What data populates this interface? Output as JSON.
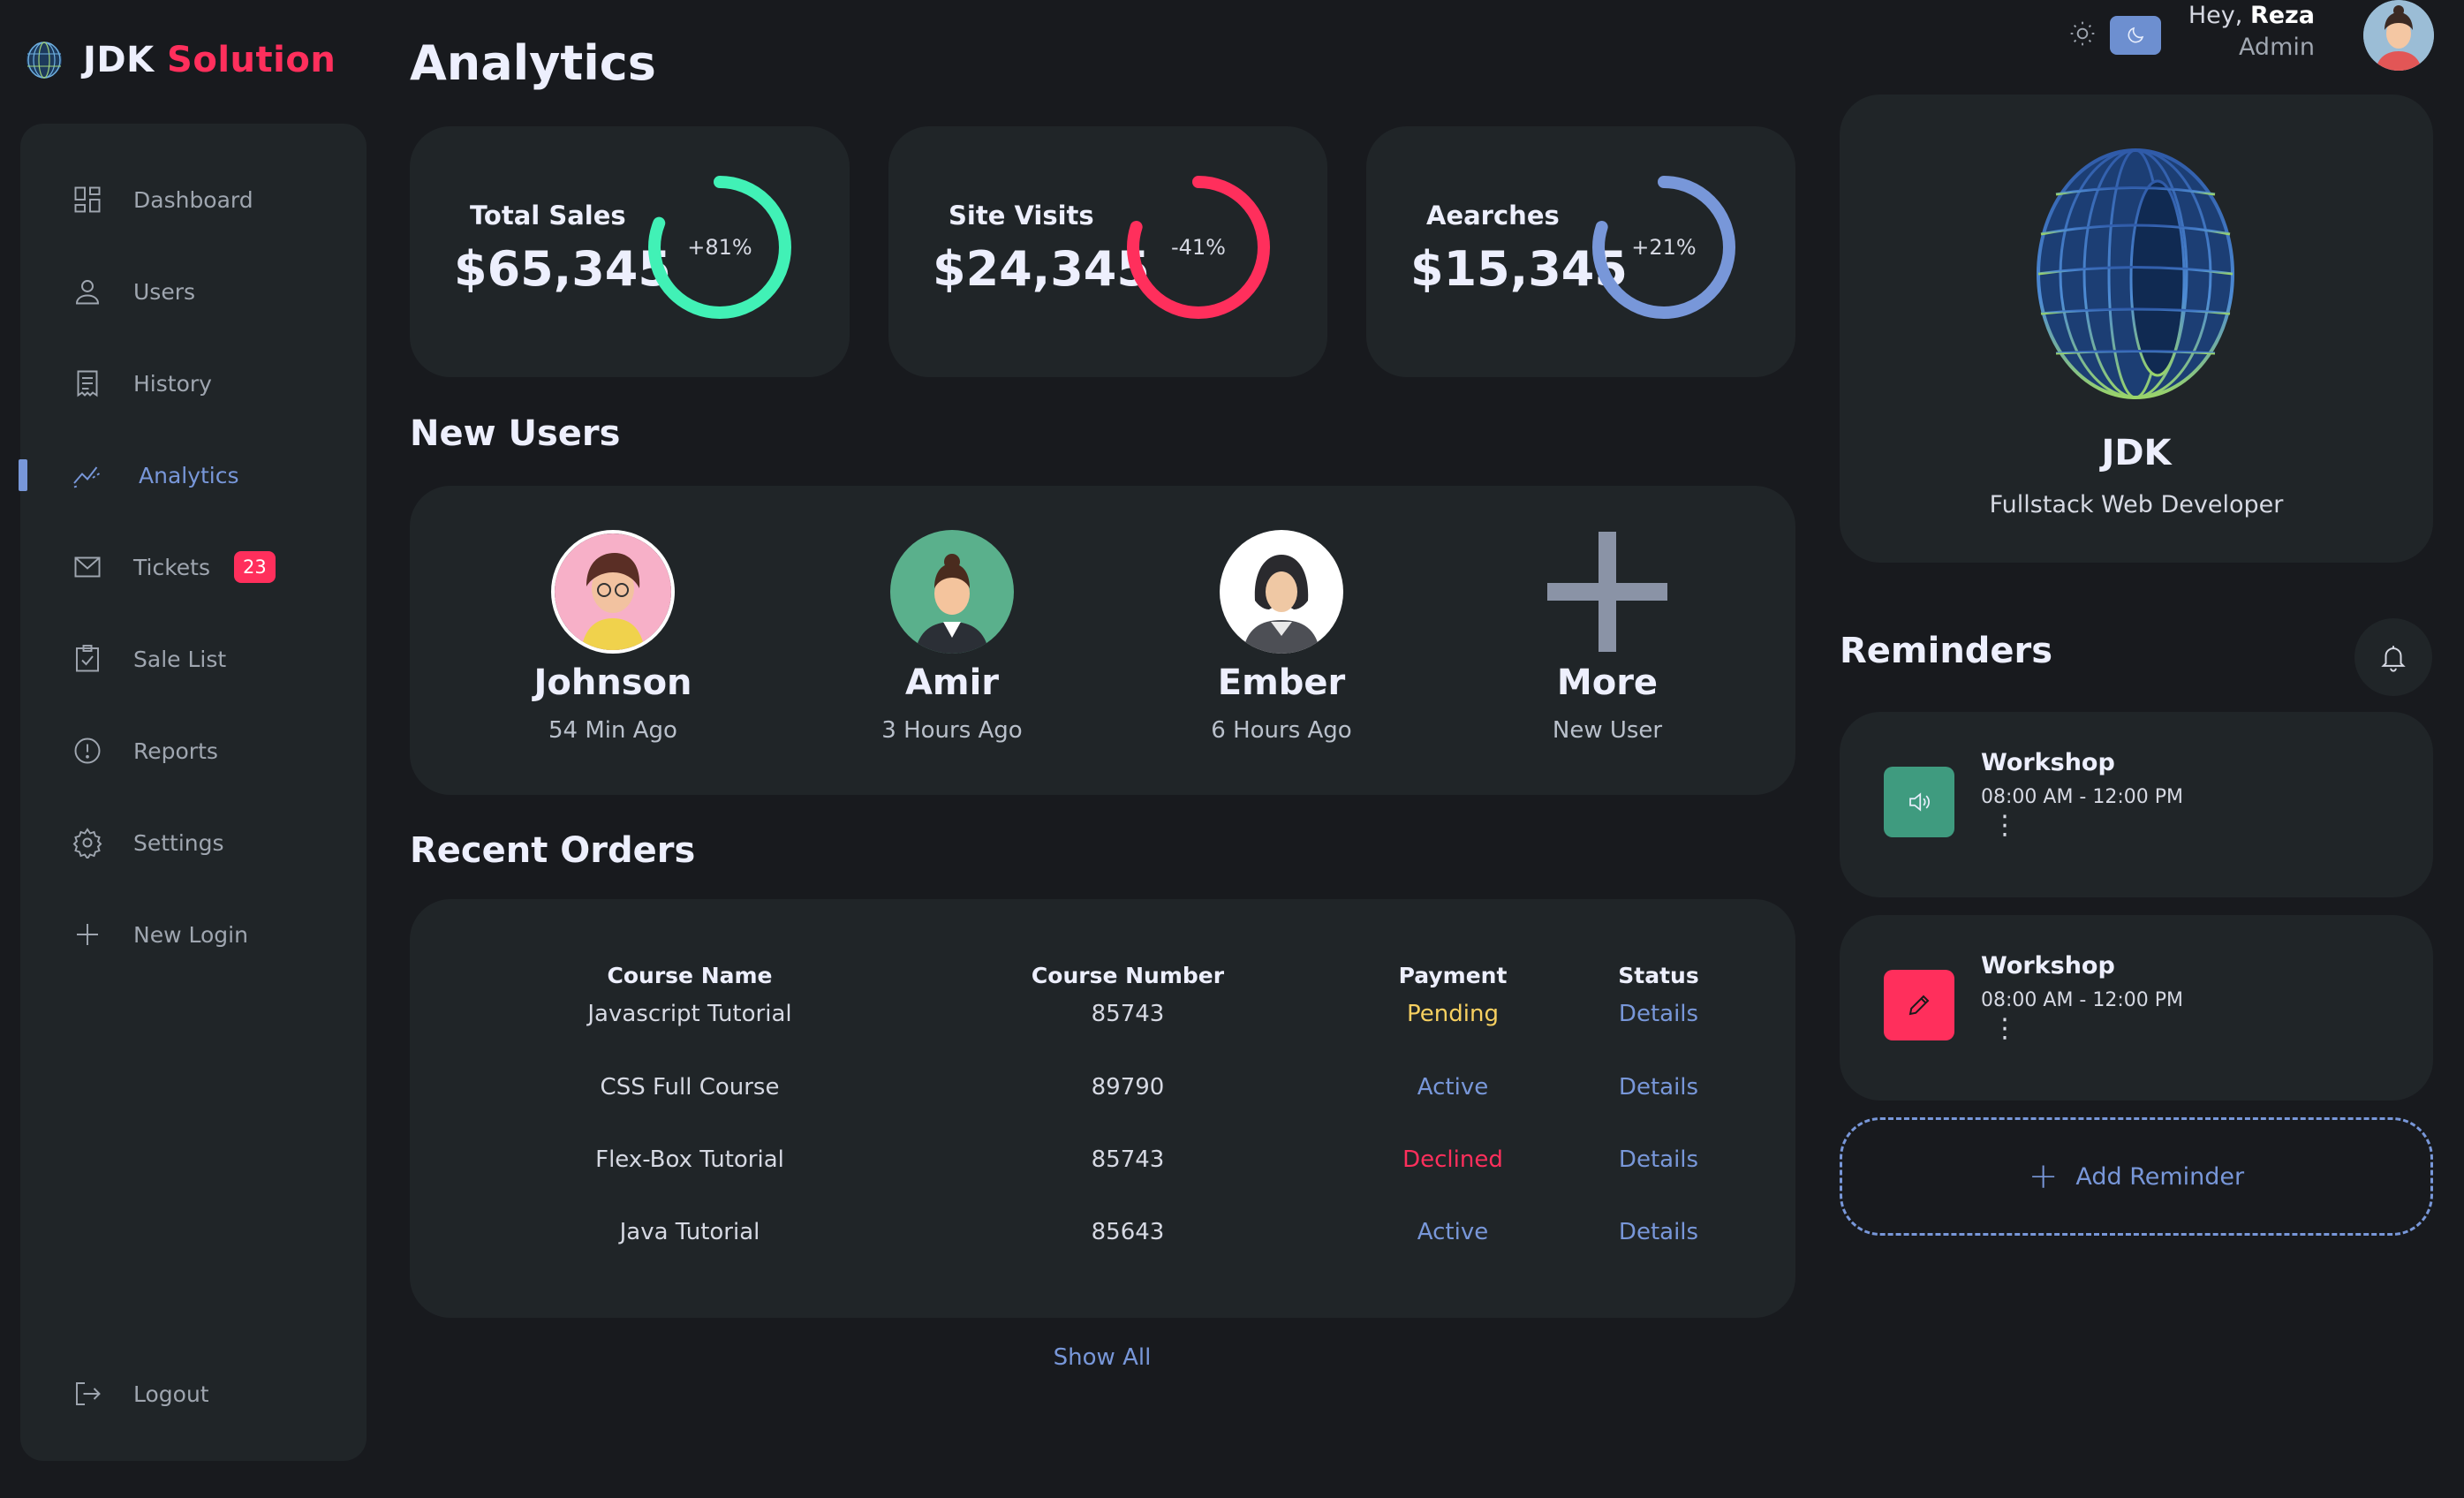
{
  "brand": {
    "part1": "JDK",
    "part2": "Solution",
    "accent": "#ff2f5c"
  },
  "sidebar": {
    "items": [
      {
        "label": "Dashboard",
        "icon": "grid-icon"
      },
      {
        "label": "Users",
        "icon": "user-icon"
      },
      {
        "label": "History",
        "icon": "receipt-icon"
      },
      {
        "label": "Analytics",
        "icon": "analytics-icon",
        "active": true
      },
      {
        "label": "Tickets",
        "icon": "mail-icon",
        "badge": "23"
      },
      {
        "label": "Sale List",
        "icon": "clipboard-icon"
      },
      {
        "label": "Reports",
        "icon": "alert-circle-icon"
      },
      {
        "label": "Settings",
        "icon": "gear-icon"
      },
      {
        "label": "New Login",
        "icon": "plus-icon"
      }
    ],
    "logout": "Logout"
  },
  "header": {
    "greeting_prefix": "Hey,",
    "user_name": "Reza",
    "role": "Admin",
    "theme": "dark"
  },
  "main": {
    "title": "Analytics",
    "stats": [
      {
        "label": "Total Sales",
        "value": "$65,345",
        "change": "+81%",
        "color": "#41f1b6",
        "fraction": 0.81
      },
      {
        "label": "Site Visits",
        "value": "$24,345",
        "change": "-41%",
        "color": "#ff2f5c",
        "fraction": 0.8
      },
      {
        "label": "Aearches",
        "value": "$15,345",
        "change": "+21%",
        "color": "#7897d9",
        "fraction": 0.8
      }
    ],
    "new_users_title": "New Users",
    "new_users": [
      {
        "name": "Johnson",
        "time": "54 Min Ago"
      },
      {
        "name": "Amir",
        "time": "3 Hours Ago"
      },
      {
        "name": "Ember",
        "time": "6 Hours Ago"
      },
      {
        "name": "More",
        "time": "New User"
      }
    ],
    "orders_title": "Recent Orders",
    "orders_columns": [
      "Course Name",
      "Course Number",
      "Payment",
      "Status"
    ],
    "orders": [
      {
        "name": "Javascript Tutorial",
        "number": "85743",
        "payment": "Pending",
        "status": "Details"
      },
      {
        "name": "CSS Full Course",
        "number": "89790",
        "payment": "Active",
        "status": "Details"
      },
      {
        "name": "Flex-Box Tutorial",
        "number": "85743",
        "payment": "Declined",
        "status": "Details"
      },
      {
        "name": "Java Tutorial",
        "number": "85643",
        "payment": "Active",
        "status": "Details"
      }
    ],
    "show_all": "Show All"
  },
  "profile": {
    "name": "JDK",
    "role": "Fullstack Web Developer"
  },
  "reminders": {
    "title": "Reminders",
    "items": [
      {
        "title": "Workshop",
        "time": "08:00 AM - 12:00 PM",
        "icon": "volume-icon",
        "color": "#3f9b7f"
      },
      {
        "title": "Workshop",
        "time": "08:00 AM - 12:00 PM",
        "icon": "pencil-icon",
        "color": "#ff2f5c"
      }
    ],
    "add_label": "Add Reminder"
  }
}
